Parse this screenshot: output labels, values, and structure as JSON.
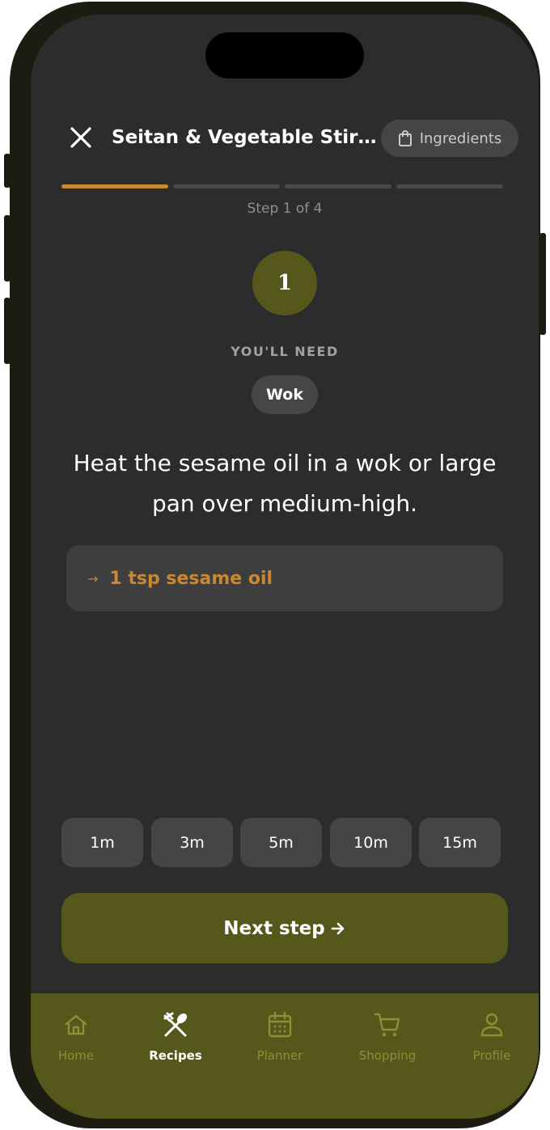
{
  "header": {
    "title": "Seitan & Vegetable Stir-…",
    "ingredients_label": "Ingredients"
  },
  "progress": {
    "current_step": 1,
    "total_steps": 4,
    "label": "Step 1 of 4"
  },
  "step": {
    "number": "1",
    "you_need_label": "YOU'LL NEED",
    "equipment": [
      "Wok"
    ],
    "instruction": "Heat the sesame oil in a wok or large pan over medium-high.",
    "ingredient": "1 tsp sesame oil"
  },
  "timers": [
    "1m",
    "3m",
    "5m",
    "10m",
    "15m"
  ],
  "next_button": "Next step",
  "tabs": [
    {
      "label": "Home",
      "icon": "home-icon",
      "active": false
    },
    {
      "label": "Recipes",
      "icon": "fork-spoon-icon",
      "active": true
    },
    {
      "label": "Planner",
      "icon": "calendar-icon",
      "active": false
    },
    {
      "label": "Shopping",
      "icon": "cart-icon",
      "active": false
    },
    {
      "label": "Profile",
      "icon": "person-icon",
      "active": false
    }
  ],
  "colors": {
    "accent": "#c98832",
    "olive": "#55581a",
    "background": "#2c2c2c"
  }
}
